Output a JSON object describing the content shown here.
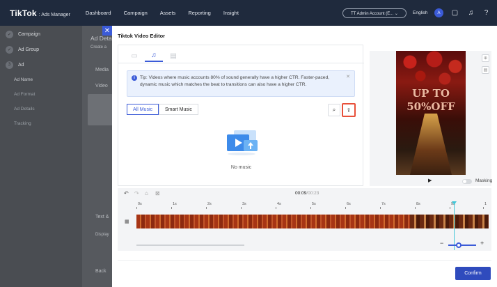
{
  "topbar": {
    "logo_main": "TikTok",
    "logo_sub": ": Ads Manager",
    "nav": [
      "Dashboard",
      "Campaign",
      "Assets",
      "Reporting",
      "Insight"
    ],
    "account": "TT Admin Account (E...  ⌄",
    "language": "English",
    "avatar_initial": "A"
  },
  "sidebar": {
    "steps": [
      {
        "label": "Campaign",
        "mark": "✓"
      },
      {
        "label": "Ad Group",
        "mark": "✓"
      },
      {
        "label": "Ad",
        "mark": "3"
      }
    ],
    "subitems": [
      "Ad Name",
      "Ad Format",
      "Ad Details",
      "Tracking"
    ]
  },
  "background": {
    "title": "Ad Deta",
    "subtitle": "Create a",
    "media": "Media",
    "video": "Video",
    "text_block": "Text &",
    "display": "Display",
    "back": "Back"
  },
  "editor": {
    "title": "Tiktok Video Editor",
    "tip": "Tip: Videos where music accounts 80% of sound generally have a higher CTR. Faster-paced, dynamic music which matches the beat to transitions can also have a higher CTR.",
    "tabs": {
      "all": "All Music",
      "smart": "Smart Music"
    },
    "empty_text": "No music",
    "preview": {
      "promo_line1": "UP TO",
      "promo_line2": "50%OFF",
      "masking_label": "Masking"
    },
    "timeline": {
      "current_time": "00:09",
      "total_time": "/00:23",
      "ticks": [
        "0s",
        "1s",
        "2s",
        "3s",
        "4s",
        "5s",
        "6s",
        "7s",
        "8s",
        "9s",
        "1"
      ]
    },
    "confirm_label": "Confirm"
  }
}
